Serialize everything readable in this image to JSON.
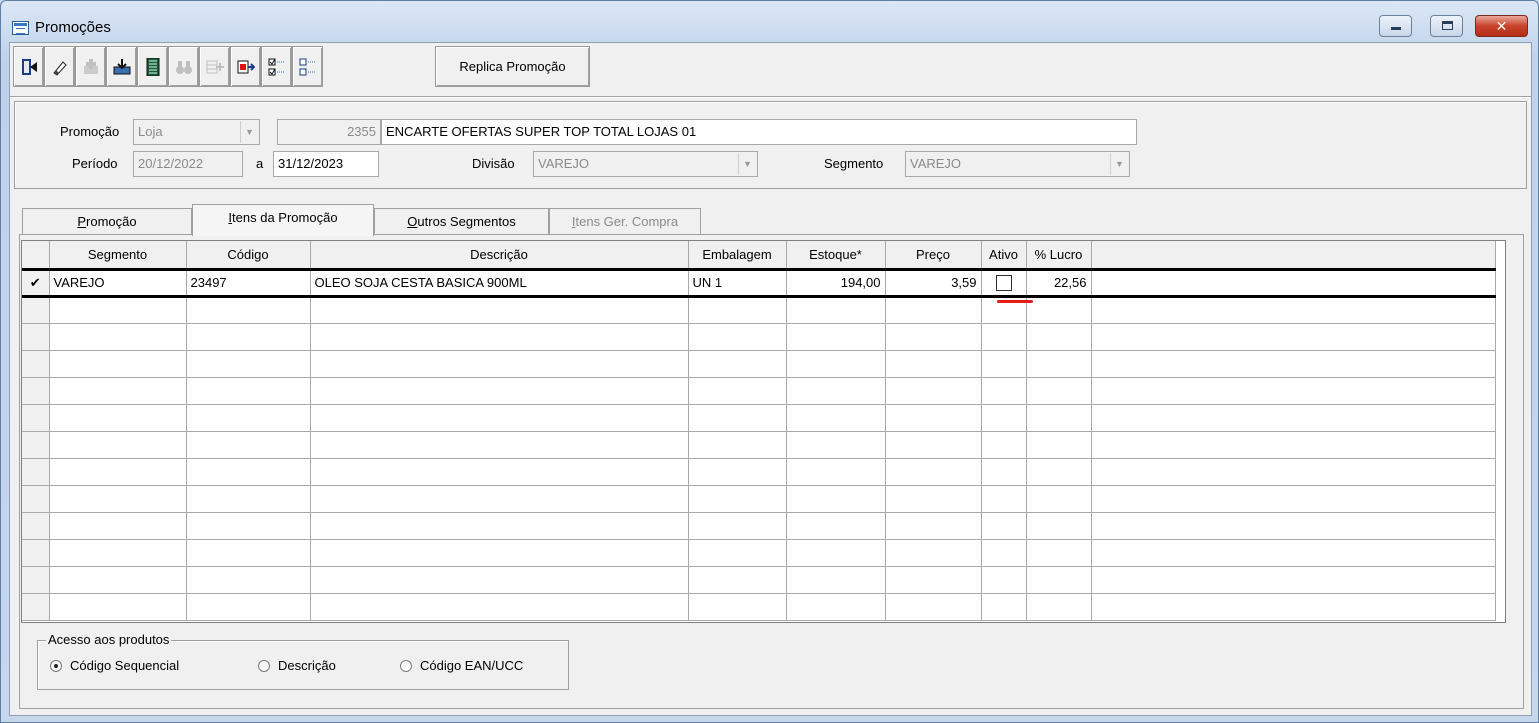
{
  "window": {
    "title": "Promoções"
  },
  "toolbar": {
    "buttons": [
      {
        "icon": "exit-door-icon",
        "enabled": true
      },
      {
        "icon": "eraser-icon",
        "enabled": true
      },
      {
        "icon": "add-icon",
        "enabled": false
      },
      {
        "icon": "import-icon",
        "enabled": true
      },
      {
        "icon": "spreadsheet-icon",
        "enabled": true
      },
      {
        "icon": "binoculars-icon",
        "enabled": false
      },
      {
        "icon": "insert-row-icon",
        "enabled": false
      },
      {
        "icon": "transfer-icon",
        "enabled": true
      },
      {
        "icon": "check-all-icon",
        "enabled": true
      },
      {
        "icon": "uncheck-all-icon",
        "enabled": true
      }
    ],
    "replica_label": "Replica Promoção"
  },
  "header": {
    "promocao_label": "Promoção",
    "promocao_tipo": "Loja",
    "promocao_codigo": "2355",
    "promocao_descricao": "ENCARTE OFERTAS SUPER TOP TOTAL LOJAS 01",
    "periodo_label": "Período",
    "periodo_inicio": "20/12/2022",
    "periodo_sep": "a",
    "periodo_fim": "31/12/2023",
    "divisao_label": "Divisão",
    "divisao_value": "VAREJO",
    "segmento_label": "Segmento",
    "segmento_value": "VAREJO"
  },
  "tabs": [
    {
      "label_u": "P",
      "label_rest": "romoção",
      "active": false,
      "disabled": false
    },
    {
      "label_u": "I",
      "label_rest": "tens da Promoção",
      "active": true,
      "disabled": false
    },
    {
      "label_u": "O",
      "label_rest": "utros Segmentos",
      "active": false,
      "disabled": false
    },
    {
      "label_u": "I",
      "label_rest": "tens Ger. Compra",
      "active": false,
      "disabled": true
    }
  ],
  "grid": {
    "columns": [
      "Segmento",
      "Código",
      "Descrição",
      "Embalagem",
      "Estoque*",
      "Preço",
      "Ativo",
      "% Lucro"
    ],
    "rows": [
      {
        "indicator": "✔",
        "segmento": "VAREJO",
        "codigo": "23497",
        "descricao": "OLEO SOJA CESTA BASICA 900ML",
        "embalagem": "UN 1",
        "estoque": "194,00",
        "preco": "3,59",
        "ativo": false,
        "lucro": "22,56"
      }
    ]
  },
  "acesso": {
    "title": "Acesso aos produtos",
    "options": [
      {
        "label": "Código Sequencial",
        "selected": true
      },
      {
        "label": "Descrição",
        "selected": false
      },
      {
        "label": "Código EAN/UCC",
        "selected": false
      }
    ]
  }
}
